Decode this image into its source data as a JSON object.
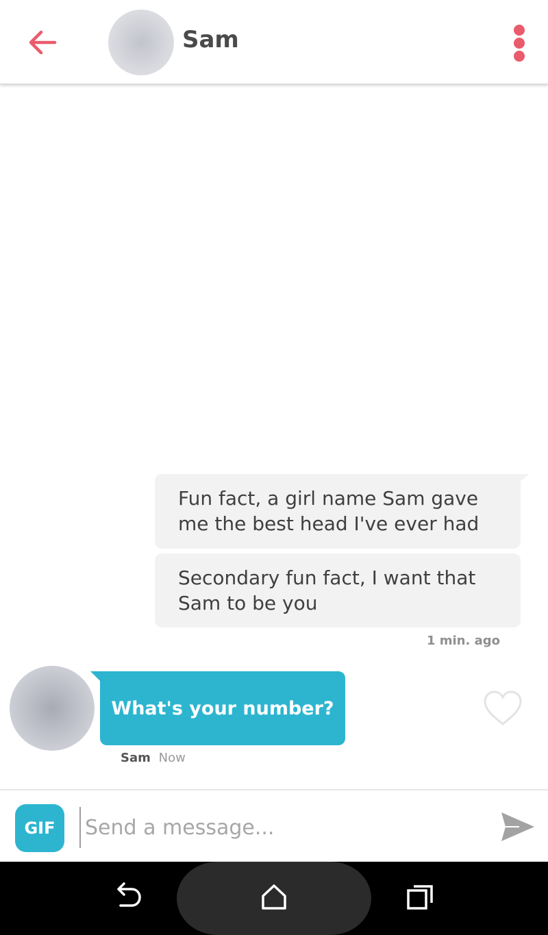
{
  "header": {
    "contact_name": "Sam",
    "back_icon": "arrow-left-icon",
    "menu_icon": "vertical-dots-icon",
    "accent_color": "#ea5b6b"
  },
  "messages": {
    "outgoing": [
      {
        "text_line1": "Fun fact, a girl name Sam gave",
        "text_line2": "me the best head I've ever had"
      },
      {
        "text_line1": "Secondary fun fact, I want that",
        "text_line2": "Sam to be you"
      }
    ],
    "outgoing_timestamp": "1 min. ago",
    "incoming": {
      "text": "What's your number?",
      "sender": "Sam",
      "time": "Now",
      "bubble_color": "#2db5d0",
      "like_icon": "heart-outline-icon"
    }
  },
  "composer": {
    "gif_label": "GIF",
    "placeholder": "Send a message...",
    "send_icon": "send-icon"
  },
  "system_nav": {
    "back_icon": "back-icon",
    "home_icon": "home-icon",
    "recents_icon": "recents-icon"
  }
}
